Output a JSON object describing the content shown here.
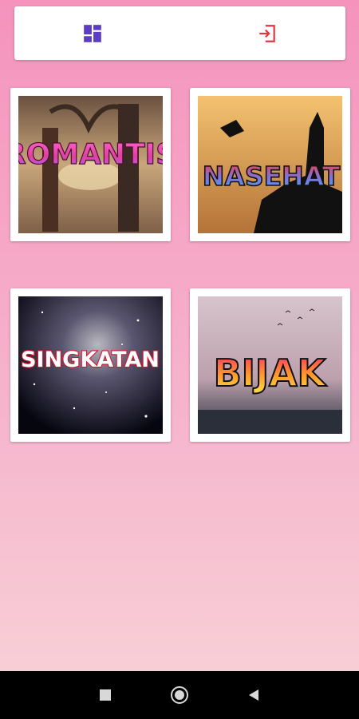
{
  "toolbar": {
    "left_icon": "dashboard-icon",
    "right_icon": "login-icon",
    "left_color": "#5b3cc4",
    "right_color": "#e8323c"
  },
  "categories": [
    {
      "label": "ROMANTIS"
    },
    {
      "label": "NASEHAT"
    },
    {
      "label": "SINGKATAN"
    },
    {
      "label": "BIJAK"
    }
  ],
  "navbar": {
    "icons": [
      "recent-apps-icon",
      "home-icon",
      "back-icon"
    ]
  }
}
